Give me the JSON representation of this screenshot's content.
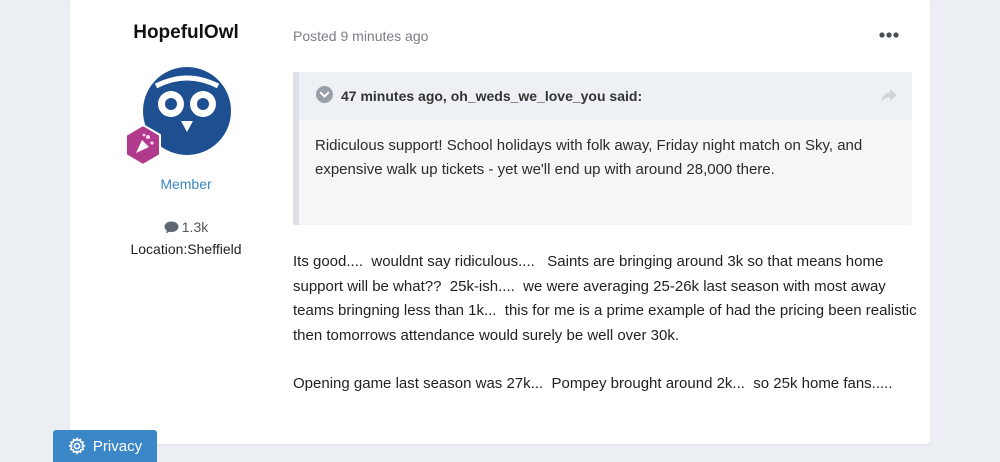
{
  "author": {
    "name": "HopefulOwl",
    "rank": "Member",
    "reaction_count": "1.3k",
    "location": "Location:Sheffield"
  },
  "post": {
    "posted": "Posted 9 minutes ago",
    "quote": {
      "cite": "47 minutes ago, oh_weds_we_love_you said:",
      "text": "Ridiculous support! School holidays with folk away, Friday night match on Sky, and expensive walk up tickets - yet we'll end up with around 28,000 there."
    },
    "paragraphs": [
      "Its good....  wouldnt say ridiculous....   Saints are bringing around 3k so that means home support will be what??  25k-ish....  we were averaging 25-26k last season with most away teams bringning less than 1k...  this for me is a prime example of had the pricing been realistic then tomorrows attendance would surely be well over 30k.",
      "Opening game last season was 27k...  Pompey brought around 2k...  so 25k home fans....."
    ]
  },
  "privacy": {
    "label": "Privacy"
  },
  "colors": {
    "accent": "#3b86c6",
    "avatar_blue": "#1d4f91",
    "badge_purple": "#b23a8c"
  }
}
